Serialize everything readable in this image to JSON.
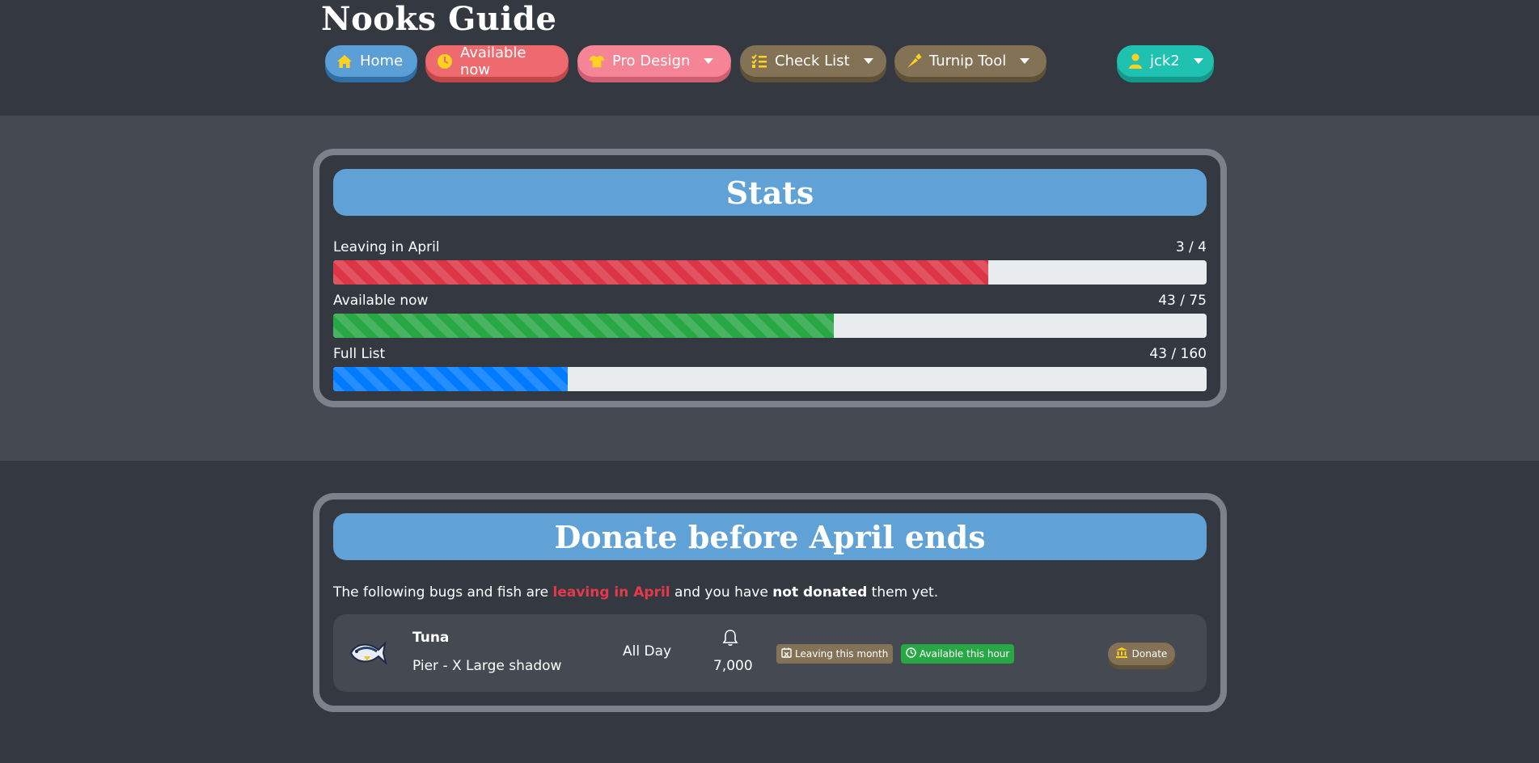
{
  "brand": "Nooks Guide",
  "nav": {
    "home": {
      "label": "Home",
      "icon": "home-icon"
    },
    "available_now": {
      "label": "Available now",
      "icon": "clock-icon"
    },
    "pro_design": {
      "label": "Pro Design",
      "icon": "tshirt-icon"
    },
    "check_list": {
      "label": "Check List",
      "icon": "checklist-icon"
    },
    "turnip_tool": {
      "label": "Turnip Tool",
      "icon": "carrot-icon"
    },
    "user": {
      "label": "jck2",
      "icon": "user-icon"
    }
  },
  "stats": {
    "title": "Stats",
    "rows": [
      {
        "label": "Leaving in April",
        "count": "3 / 4",
        "fraction": 0.75,
        "color": "#dc3545"
      },
      {
        "label": "Available now",
        "count": "43 / 75",
        "fraction": 0.5733,
        "color": "#28a745"
      },
      {
        "label": "Full List",
        "count": "43 / 160",
        "fraction": 0.2688,
        "color": "#007bff"
      }
    ]
  },
  "donate": {
    "title": "Donate before April ends",
    "intro": {
      "part1": "The following bugs and fish are ",
      "highlight1": "leaving in April",
      "part2": " and you have ",
      "highlight2": "not donated",
      "part3": " them yet."
    },
    "items": [
      {
        "icon": "tuna-fish-icon",
        "name": "Tuna",
        "location": "Pier - X Large shadow",
        "time": "All Day",
        "price_icon": "bell-icon",
        "price": "7,000",
        "badges": [
          "Leaving this month",
          "Available this hour"
        ],
        "donate_label": "Donate"
      }
    ]
  },
  "colors": {
    "header_bg": "#343841",
    "band_bg": "#454952",
    "title_bar": "#60a1d6",
    "panel_border": "#7c818b"
  }
}
